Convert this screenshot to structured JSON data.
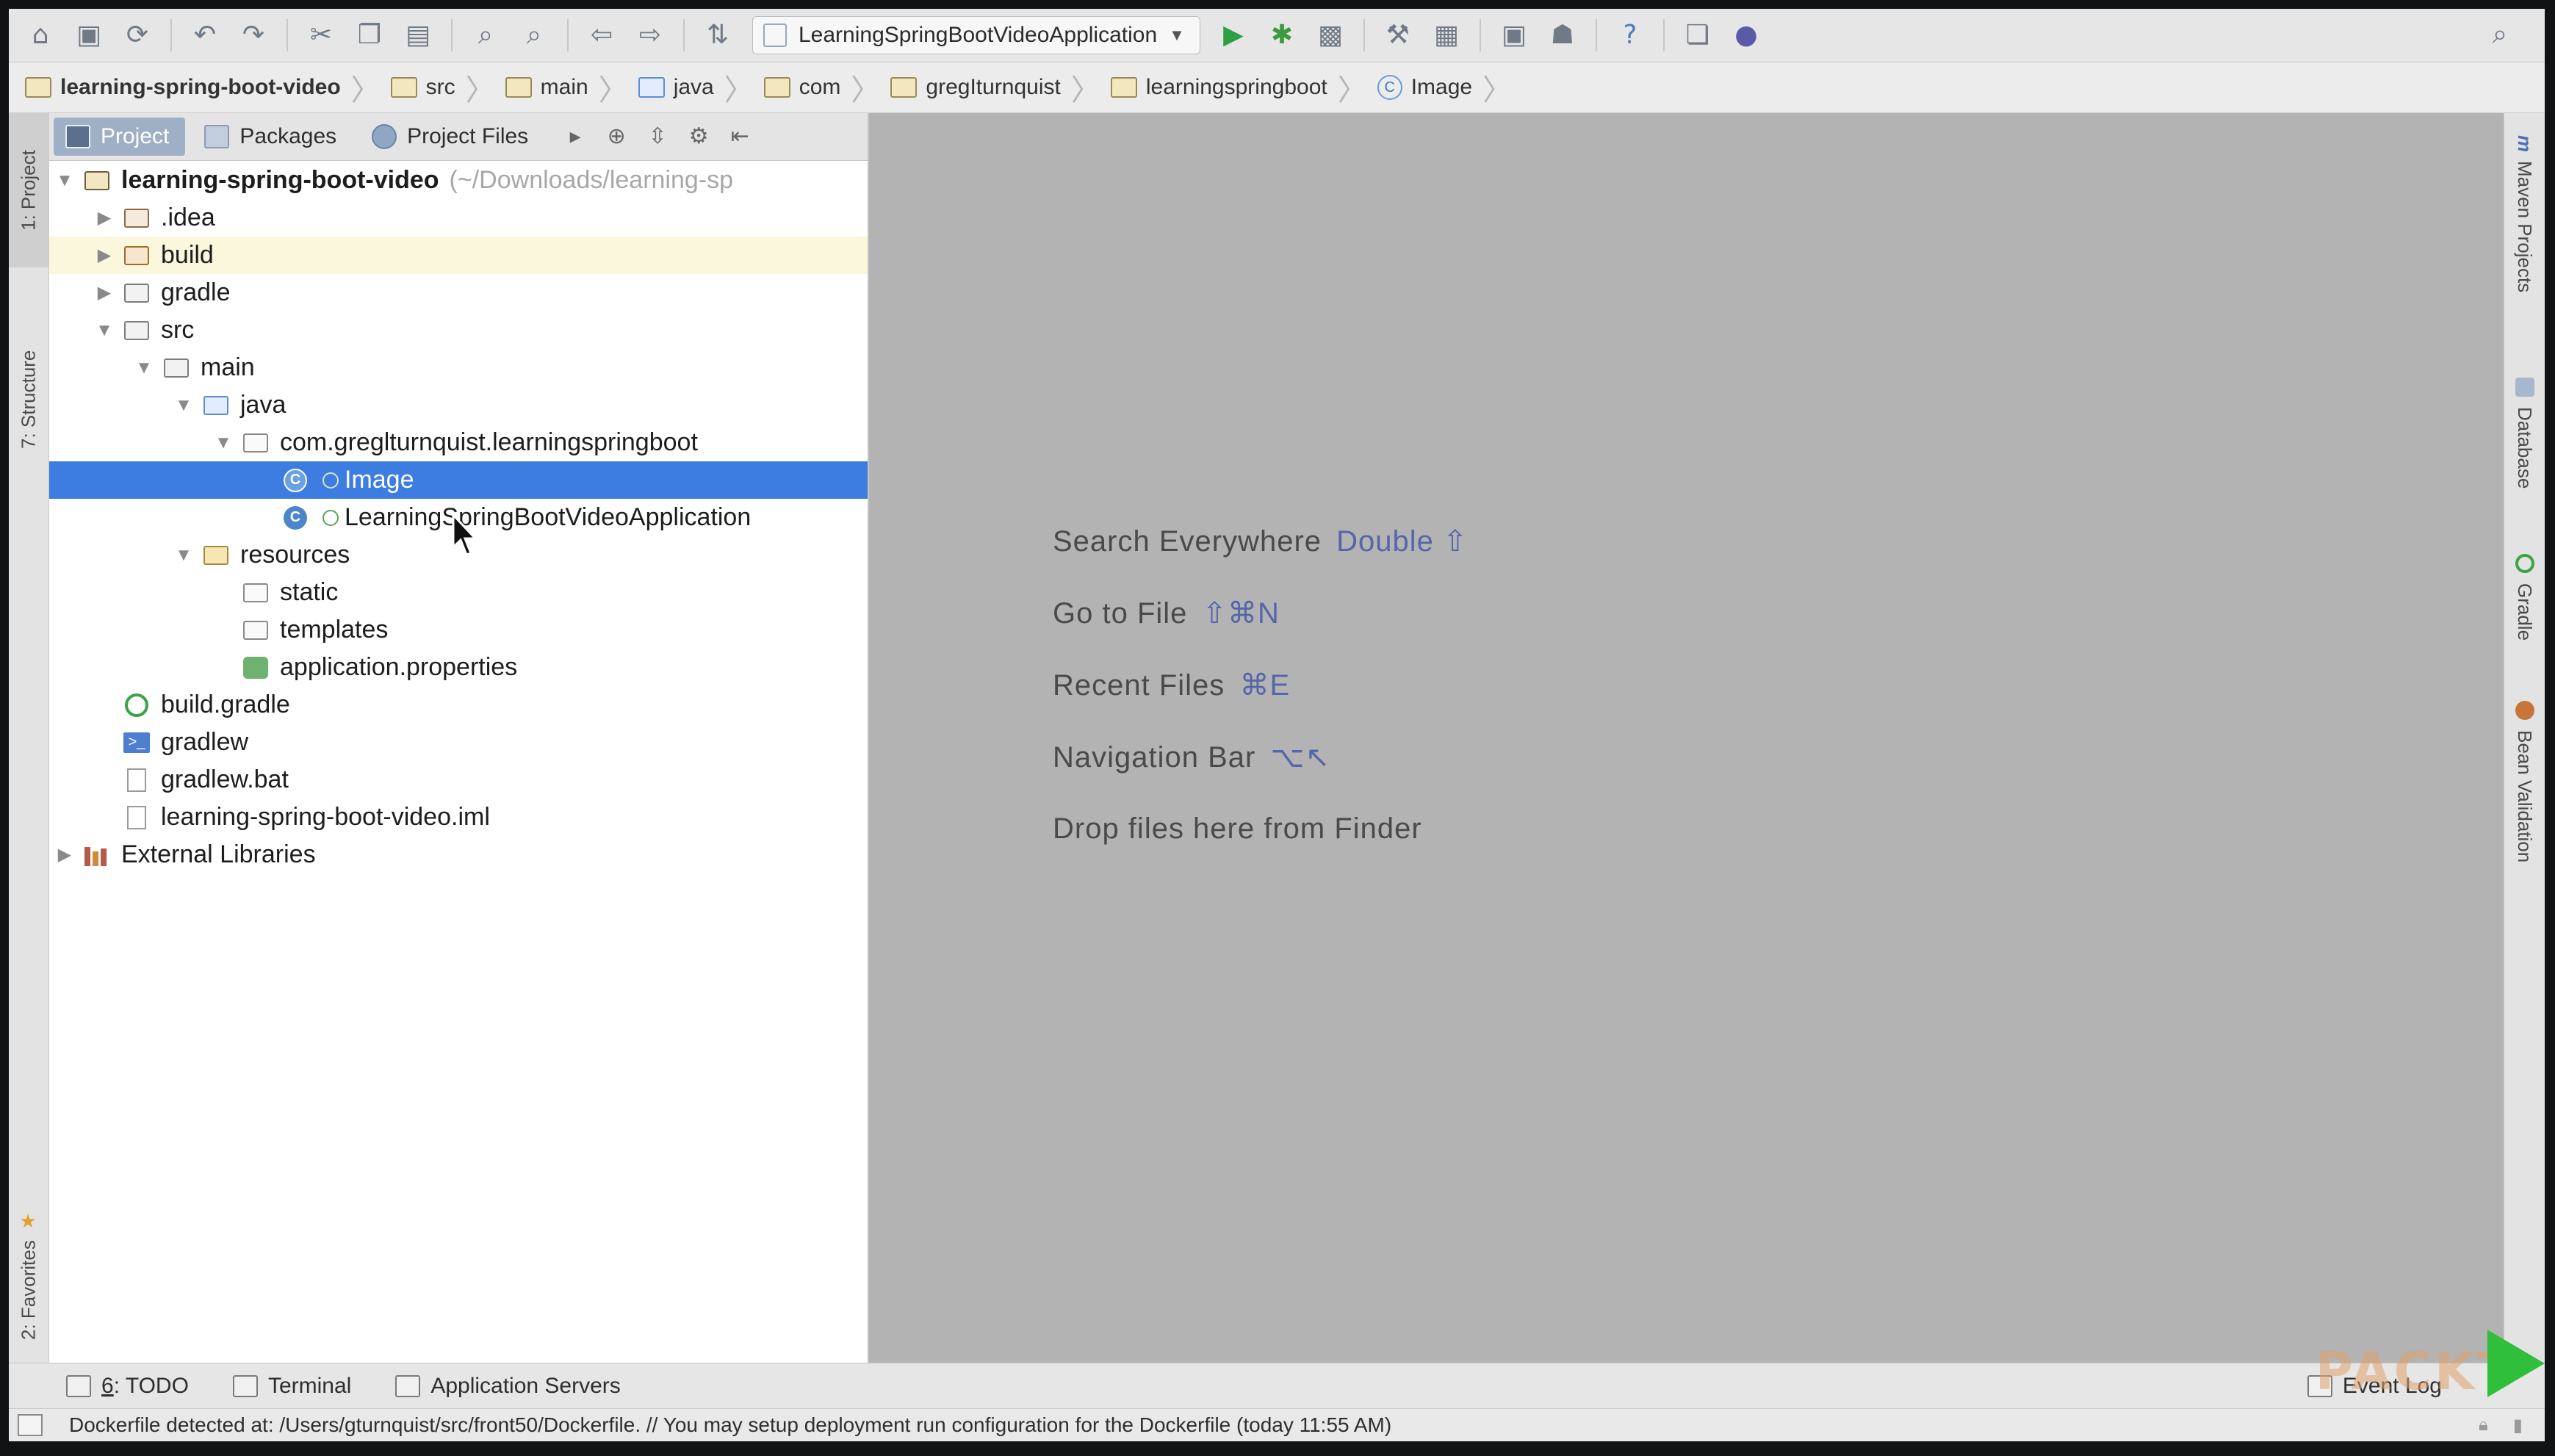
{
  "toolbar": {
    "run_config": "LearningSpringBootVideoApplication"
  },
  "breadcrumb": [
    "learning-spring-boot-video",
    "src",
    "main",
    "java",
    "com",
    "gregIturnquist",
    "learningspringboot",
    "Image"
  ],
  "left_stripe": {
    "project_tab": "1: Project",
    "structure_tab": "7: Structure",
    "favorites_tab": "2: Favorites"
  },
  "project_panel": {
    "tabs": [
      "Project",
      "Packages",
      "Project Files"
    ],
    "tree": {
      "root_name": "learning-spring-boot-video",
      "root_path": "(~/Downloads/learning-sp",
      "idea": ".idea",
      "build": "build",
      "gradle": "gradle",
      "src": "src",
      "main": "main",
      "java": "java",
      "package": "com.greglturnquist.learningspringboot",
      "image_class": "Image",
      "app_class": "LearningSpringBootVideoApplication",
      "resources": "resources",
      "static": "static",
      "templates": "templates",
      "app_props": "application.properties",
      "build_gradle": "build.gradle",
      "gradlew": "gradlew",
      "gradlew_bat": "gradlew.bat",
      "iml": "learning-spring-boot-video.iml",
      "external_libs": "External Libraries"
    }
  },
  "editor": {
    "hints": [
      {
        "label": "Search Everywhere",
        "key": "Double ⇧"
      },
      {
        "label": "Go to File",
        "key": "⇧⌘N"
      },
      {
        "label": "Recent Files",
        "key": "⌘E"
      },
      {
        "label": "Navigation Bar",
        "key": "⌥↖"
      },
      {
        "label": "Drop files here from Finder",
        "key": ""
      }
    ]
  },
  "right_stripe": {
    "maven": "Maven Projects",
    "database": "Database",
    "gradle": "Gradle",
    "bean_validation": "Bean Validation"
  },
  "bottom_tools": {
    "todo_num": "6",
    "todo_label": ": TODO",
    "terminal": "Terminal",
    "app_servers": "Application Servers",
    "event_log": "Event Log"
  },
  "status": {
    "message": "Dockerfile detected at: /Users/gturnquist/src/front50/Dockerfile. // You may setup deployment run configuration for the Dockerfile (today 11:55 AM)"
  },
  "watermark": "PACKT",
  "colors": {
    "selection": "#3d7ce0",
    "editor_bg": "#b3b3b3",
    "shortcut": "#5566aa"
  }
}
